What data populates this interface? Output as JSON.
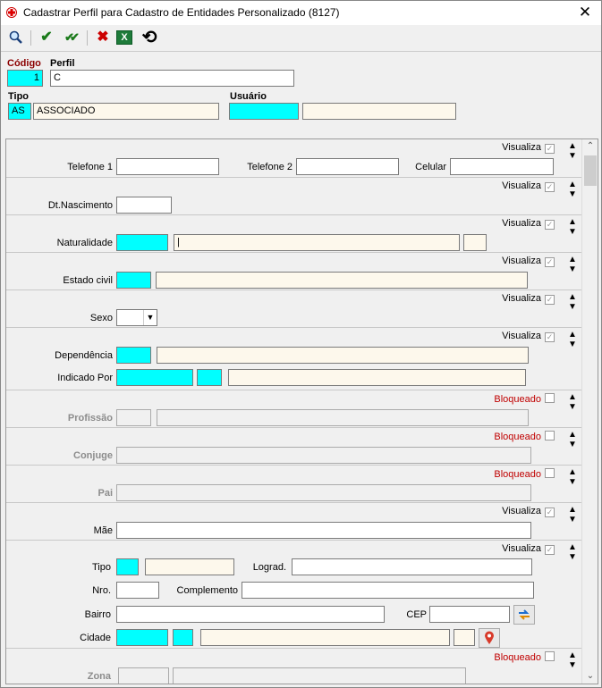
{
  "window": {
    "title": "Cadastrar Perfil para Cadastro de Entidades Personalizado (8127)",
    "close": "✕"
  },
  "toolbar": {
    "search": "🔍",
    "confirm": "✔",
    "confirm_all": "✔✔",
    "cancel": "✖",
    "excel": "X",
    "history": "⟲"
  },
  "header": {
    "codigo_label": "Código",
    "codigo_value": "1",
    "perfil_label": "Perfil",
    "perfil_value": "C",
    "tipo_label": "Tipo",
    "tipo_code": "AS",
    "tipo_desc": "ASSOCIADO",
    "usuario_label": "Usuário",
    "usuario_code": "",
    "usuario_name": ""
  },
  "sections": {
    "visualiza": "Visualiza",
    "bloqueado": "Bloqueado",
    "check": "✓",
    "arrow_up": "▲",
    "arrow_down": "▼",
    "telefone1": "Telefone 1",
    "telefone2": "Telefone 2",
    "celular": "Celular",
    "dt_nascimento": "Dt.Nascimento",
    "naturalidade": "Naturalidade",
    "naturalidade_value": "|",
    "estado_civil": "Estado civil",
    "sexo": "Sexo",
    "dependencia": "Dependência",
    "indicado_por": "Indicado Por",
    "profissao": "Profissão",
    "conjuge": "Conjuge",
    "pai": "Pai",
    "mae": "Mãe",
    "tipo": "Tipo",
    "lograd": "Lograd.",
    "nro": "Nro.",
    "complemento": "Complemento",
    "bairro": "Bairro",
    "cep": "CEP",
    "cidade": "Cidade",
    "zona": "Zona"
  }
}
